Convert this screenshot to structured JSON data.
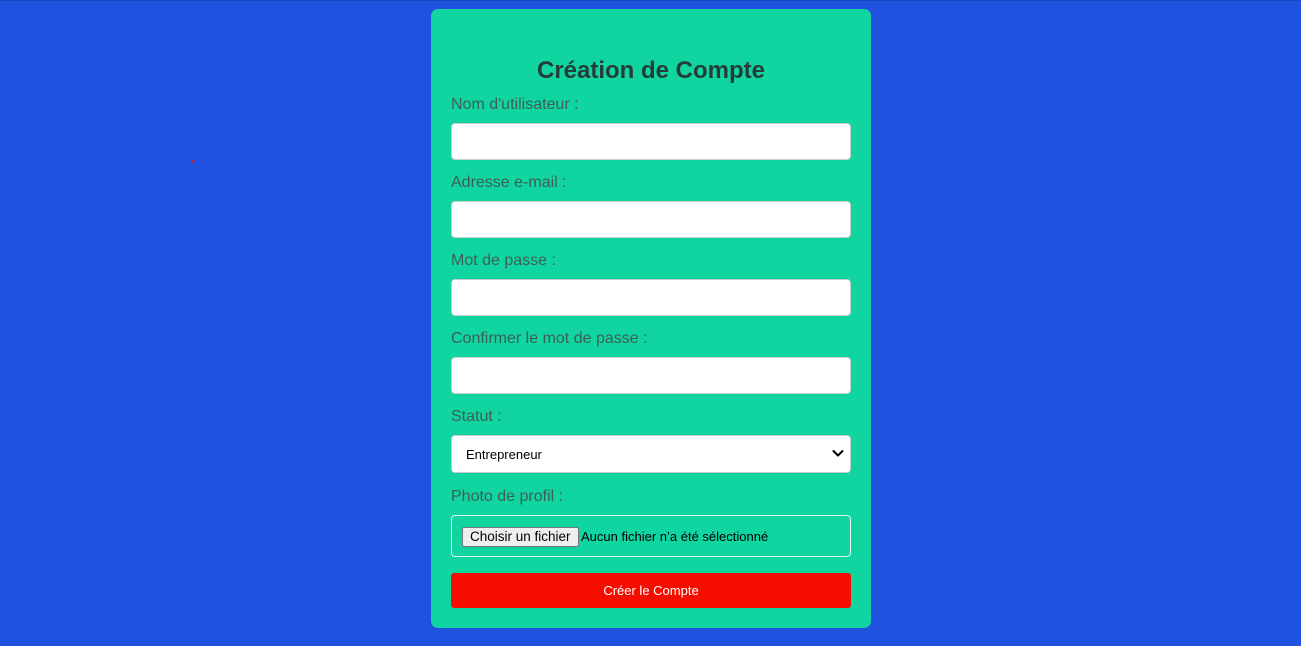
{
  "form": {
    "title": "Création de Compte",
    "fields": {
      "username": {
        "label": "Nom d'utilisateur :",
        "value": ""
      },
      "email": {
        "label": "Adresse e-mail :",
        "value": ""
      },
      "password": {
        "label": "Mot de passe :",
        "value": ""
      },
      "confirm_password": {
        "label": "Confirmer le mot de passe :",
        "value": ""
      }
    },
    "status": {
      "label": "Statut :",
      "selected": "Entrepreneur"
    },
    "photo": {
      "label": "Photo de profil :",
      "button_label": "Choisir un fichier",
      "status_text": "Aucun fichier n’a été sélectionné"
    },
    "submit_label": "Créer le Compte"
  },
  "colors": {
    "page_background": "#1f53df",
    "card_background": "#11d5a1",
    "submit_background": "#f50d00",
    "label_text": "#3d5e58",
    "title_text": "#263c38"
  },
  "icons": {
    "select_chevron": "chevron-down-icon"
  }
}
